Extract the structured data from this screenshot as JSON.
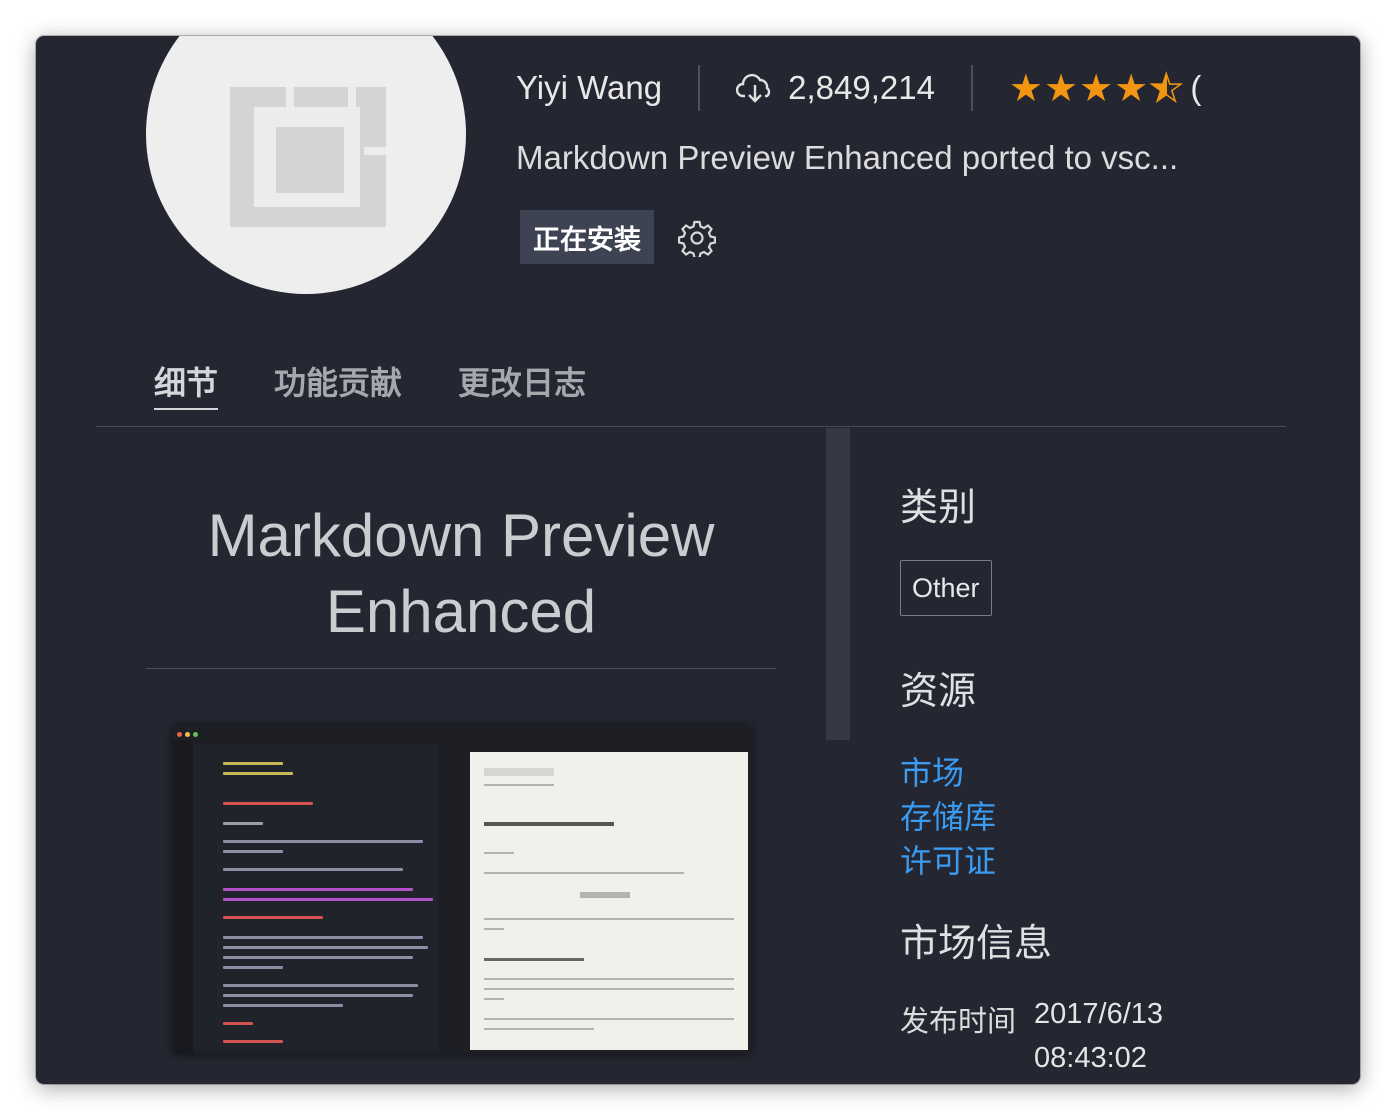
{
  "header": {
    "author": "Yiyi Wang",
    "installs": "2,849,214",
    "rating_stars": 4.5,
    "description": "Markdown Preview Enhanced ported to vsc..."
  },
  "actions": {
    "install_status": "正在安装"
  },
  "tabs": [
    "细节",
    "功能贡献",
    "更改日志"
  ],
  "readme": {
    "title_line1": "Markdown Preview",
    "title_line2": "Enhanced"
  },
  "sidebar": {
    "categories_title": "类别",
    "category_tag": "Other",
    "resources_title": "资源",
    "resources": [
      "市场",
      "存储库",
      "许可证"
    ],
    "market_title": "市场信息",
    "release_label": "发布时间",
    "release_date": "2017/6/13",
    "release_time": "08:43:02"
  },
  "colors": {
    "background": "#242731",
    "link": "#3b9bf0",
    "star": "#f29611"
  }
}
